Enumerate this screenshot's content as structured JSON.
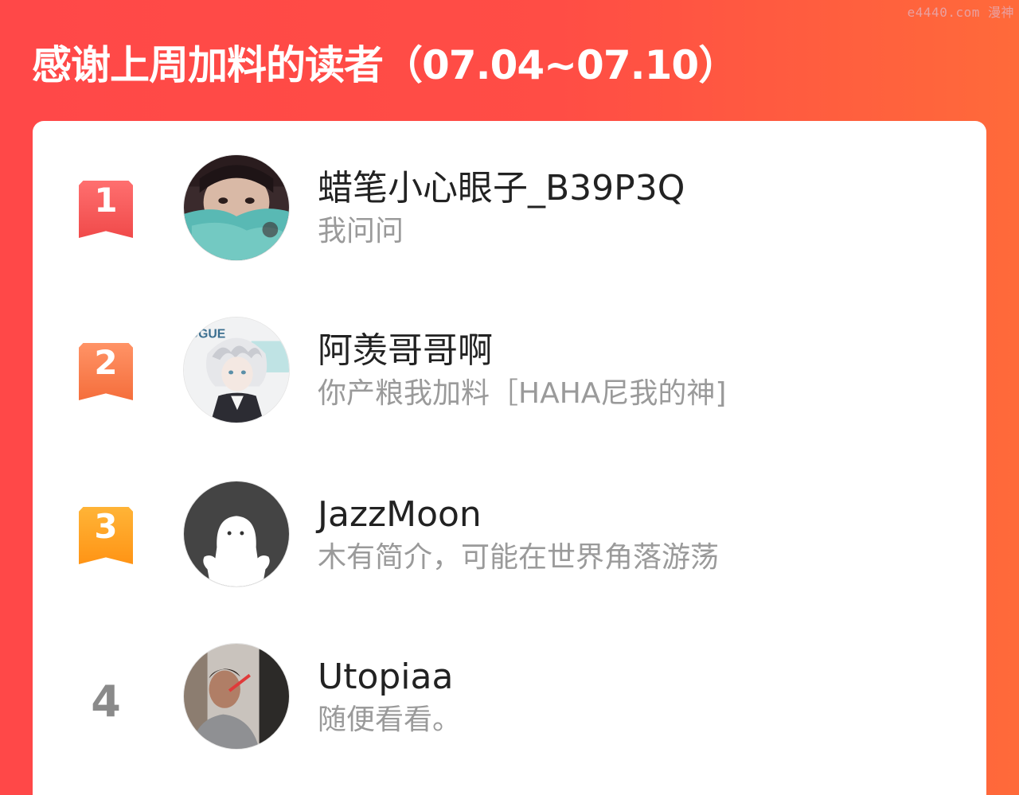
{
  "watermark": "e4440.com 漫神",
  "header": {
    "title": "感谢上周加料的读者（07.04~07.10）"
  },
  "colors": {
    "background": "#ff4d45",
    "rank1": "#f45858",
    "rank2": "#f77b4c",
    "rank3": "#ffa326"
  },
  "readers": [
    {
      "rank": "1",
      "name": "蜡笔小心眼子_B39P3Q",
      "bio": "我问问",
      "avatar_icon": "girl-portrait-avatar"
    },
    {
      "rank": "2",
      "name": "阿羡哥哥啊",
      "bio": "你产粮我加料［HAHA尼我的神]",
      "avatar_icon": "anime-character-avatar"
    },
    {
      "rank": "3",
      "name": "JazzMoon",
      "bio": "木有简介，可能在世界角落游荡",
      "avatar_icon": "default-ghost-avatar"
    },
    {
      "rank": "4",
      "name": "Utopiaa",
      "bio": "随便看看。",
      "avatar_icon": "man-portrait-avatar"
    }
  ]
}
